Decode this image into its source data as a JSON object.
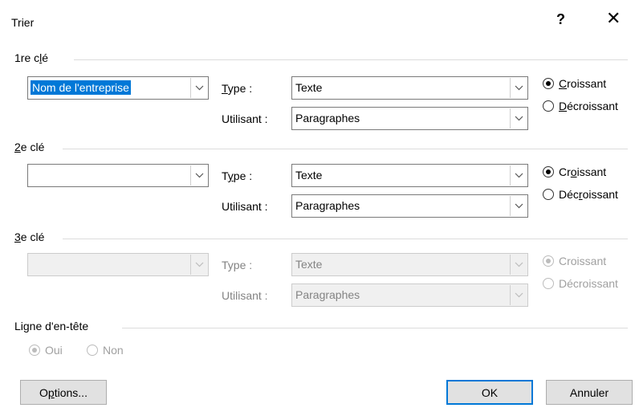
{
  "window": {
    "title": "Trier",
    "help_glyph": "?",
    "close_glyph": "✕"
  },
  "key1": {
    "label_pre": "1re c",
    "label_ul": "l",
    "label_post": "é",
    "field_value": "Nom de l'entreprise",
    "type_ul": "T",
    "type_post": "ype :",
    "type_value": "Texte",
    "using_label": "Utilisant :",
    "using_value": "Paragraphes",
    "asc_ul": "C",
    "asc_post": "roissant",
    "desc_ul": "D",
    "desc_post": "écroissant",
    "selected": "Croissant"
  },
  "key2": {
    "label_ul": "2",
    "label_post": "e clé",
    "field_value": "",
    "type_pre": "T",
    "type_ul": "y",
    "type_post": "pe :",
    "type_value": "Texte",
    "using_label": "Utilisant :",
    "using_value": "Paragraphes",
    "asc_pre": "Cr",
    "asc_ul": "o",
    "asc_post": "issant",
    "desc_pre": "Déc",
    "desc_ul": "r",
    "desc_post": "oissant",
    "selected": "Croissant"
  },
  "key3": {
    "label_ul": "3",
    "label_post": "e clé",
    "field_value": "",
    "type_label": "Type :",
    "type_value": "Texte",
    "using_label": "Utilisant :",
    "using_value": "Paragraphes",
    "asc_label": "Croissant",
    "desc_label": "Décroissant",
    "selected": "Croissant",
    "disabled": true
  },
  "header": {
    "label": "Ligne d'en-tête",
    "yes_label": "Oui",
    "no_label": "Non",
    "selected": "Oui",
    "disabled": true
  },
  "buttons": {
    "options_pre": "O",
    "options_ul": "p",
    "options_post": "tions...",
    "ok_label": "OK",
    "cancel_label": "Annuler"
  },
  "icons": {
    "dropdown": "chevron-down-icon",
    "close": "close-icon"
  },
  "colors": {
    "selection": "#0078d7",
    "button_bg": "#e1e1e1",
    "disabled_text": "#838383"
  }
}
